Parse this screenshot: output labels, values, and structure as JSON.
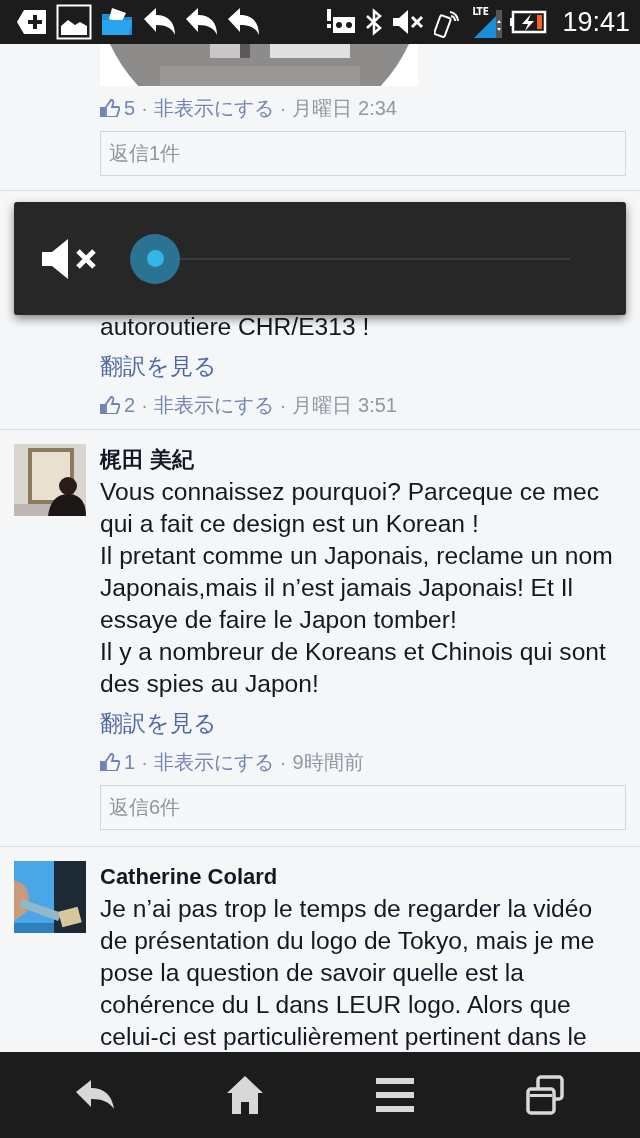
{
  "status_bar": {
    "network_label": "LTE",
    "time": "19:41"
  },
  "comments": [
    {
      "attachment": {
        "kind": "picture"
      },
      "likes": "5",
      "separators": [
        "·",
        "·"
      ],
      "hide_link": "非表示にする",
      "time": "月曜日 2:34",
      "replies_button": "返信1件"
    },
    {
      "paragraphs": [
        "autoroutiere CHR/E313 !"
      ],
      "translate_link": "翻訳を見る",
      "likes": "2",
      "separators": [
        "·",
        "·"
      ],
      "hide_link": "非表示にする",
      "time": "月曜日 3:51"
    },
    {
      "avatar": {
        "kind": "picture"
      },
      "author": "梶田 美紀",
      "paragraphs": [
        "Vous connaissez pourquoi? Parceque ce mec qui a fait ce design est un Korean !",
        "Il pretant comme un Japonais, reclame un nom Japonais,mais il n’est jamais Japonais! Et Il essaye de faire le Japon tomber!",
        "Il y a nombreur de Koreans et Chinois qui sont des spies au Japon!"
      ],
      "translate_link": "翻訳を見る",
      "likes": "1",
      "separators": [
        "·",
        "·"
      ],
      "hide_link": "非表示にする",
      "time": "9時間前",
      "replies_button": "返信6件"
    },
    {
      "avatar": {
        "kind": "picture"
      },
      "author": "Catherine Colard",
      "paragraphs": [
        "Je n’ai pas trop le temps de regarder la vidéo de présentation du logo de Tokyo, mais je me pose la question de savoir quelle est la cohérence du L dans LEUR logo. Alors que celui-ci est particulièrement pertinent dans le"
      ]
    }
  ],
  "volume_panel": {
    "muted": true
  }
}
